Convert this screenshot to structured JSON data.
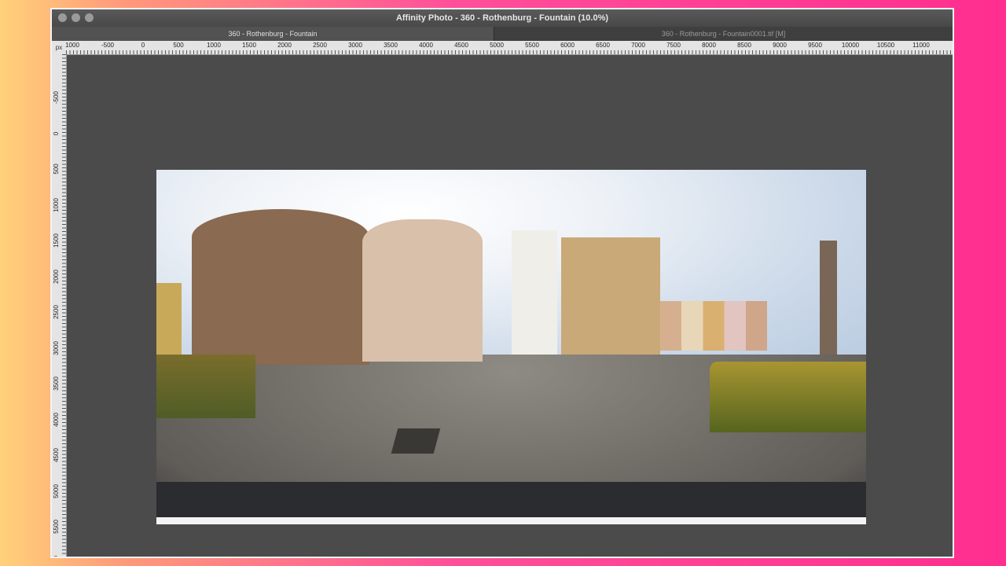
{
  "window": {
    "title": "Affinity Photo - 360 - Rothenburg - Fountain (10.0%)"
  },
  "tabs": [
    {
      "label": "360 - Rothenburg - Fountain",
      "active": true
    },
    {
      "label": "360 - Rothenburg - Fountain0001.tif [M]",
      "active": false
    }
  ],
  "ruler": {
    "unit": "px",
    "horizontal": [
      "1000",
      "-500",
      "0",
      "500",
      "1000",
      "1500",
      "2000",
      "2500",
      "3000",
      "3500",
      "4000",
      "4500",
      "5000",
      "5500",
      "6000",
      "6500",
      "7000",
      "7500",
      "8000",
      "8500",
      "9000",
      "9500",
      "10000",
      "10500",
      "11000"
    ],
    "vertical": [
      "-500",
      "0",
      "500",
      "1000",
      "1500",
      "2000",
      "2500",
      "3000",
      "3500",
      "4000",
      "4500",
      "5000",
      "5500",
      "6000"
    ]
  },
  "document": {
    "image_description": "360 panorama of Rothenburg market square with fountain"
  }
}
